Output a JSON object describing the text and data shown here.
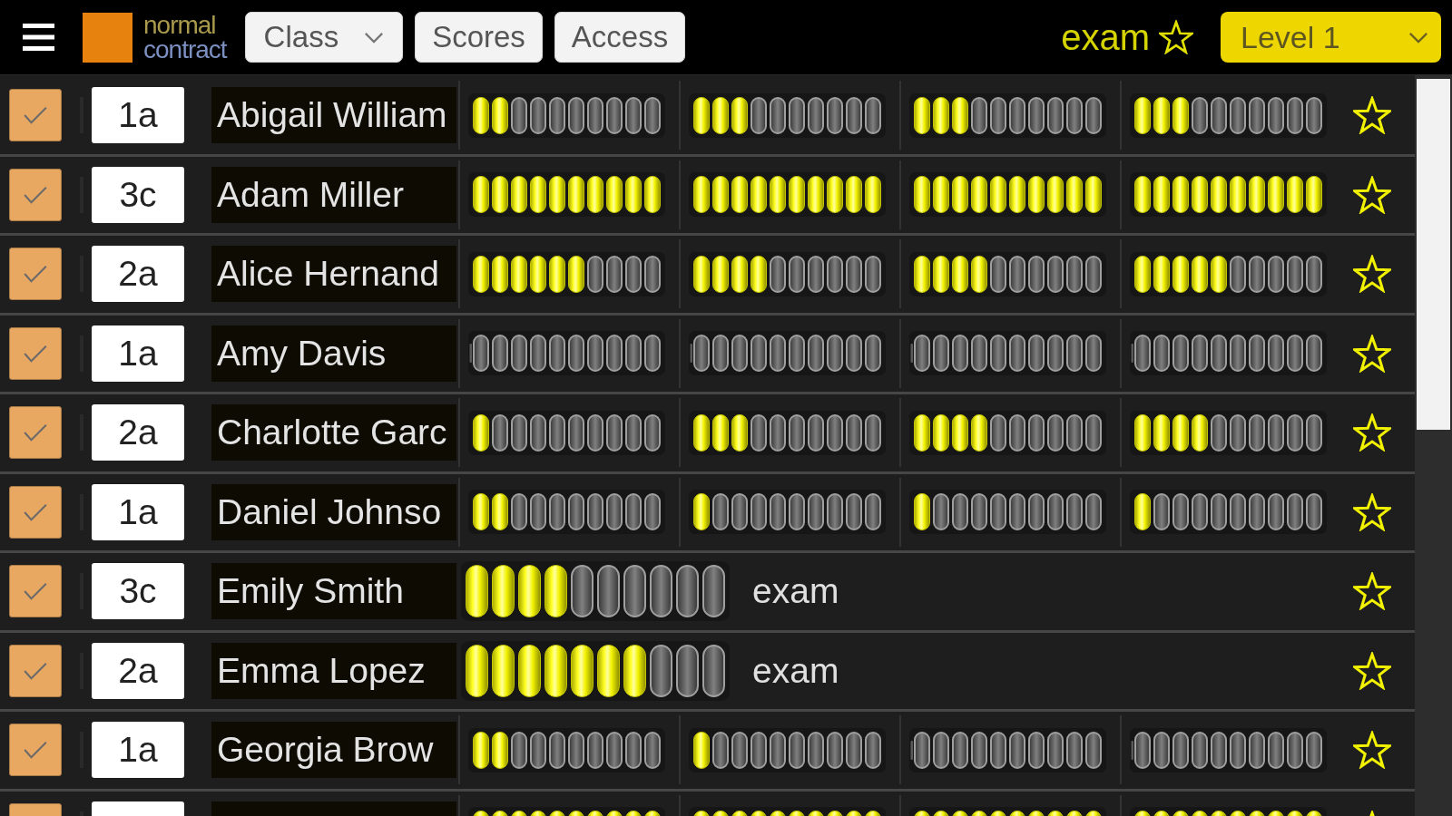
{
  "header": {
    "logo": {
      "line_1": "normal",
      "line_2": "contract"
    },
    "buttons": [
      {
        "label": "Class",
        "kind": "dropdown"
      },
      {
        "label": "Scores",
        "kind": "button"
      },
      {
        "label": "Access",
        "kind": "button"
      }
    ],
    "filter": {
      "label": "exam",
      "starred": false
    },
    "level_select": {
      "value": "Level 1"
    }
  },
  "rows": [
    {
      "checked": true,
      "class": "1a",
      "name": "Abigail William",
      "kind": "scores",
      "meters": [
        {
          "level": 0.2
        },
        {
          "level": 0.3
        },
        {
          "level": 0.3
        },
        {
          "level": 0.3
        }
      ],
      "starred": false
    },
    {
      "checked": true,
      "class": "3c",
      "name": "Adam Miller",
      "kind": "scores",
      "meters": [
        {
          "level": 1
        },
        {
          "level": 1
        },
        {
          "level": 1
        },
        {
          "level": 1
        }
      ],
      "starred": false
    },
    {
      "checked": true,
      "class": "2a",
      "name": "Alice Hernand",
      "kind": "scores",
      "meters": [
        {
          "level": 0.6
        },
        {
          "level": 0.4
        },
        {
          "level": 0.4
        },
        {
          "level": 0.5
        }
      ],
      "starred": false
    },
    {
      "checked": true,
      "class": "1a",
      "name": "Amy Davis",
      "kind": "scores",
      "meters": [
        {
          "level": 0
        },
        {
          "level": 0
        },
        {
          "level": 0
        },
        {
          "level": 0
        }
      ],
      "starred": false
    },
    {
      "checked": true,
      "class": "2a",
      "name": "Charlotte Garc",
      "kind": "scores",
      "meters": [
        {
          "level": 0.1
        },
        {
          "level": 0.3
        },
        {
          "level": 0.4
        },
        {
          "level": 0.4
        }
      ],
      "starred": false
    },
    {
      "checked": true,
      "class": "1a",
      "name": "Daniel Johnso",
      "kind": "scores",
      "meters": [
        {
          "level": 0.2
        },
        {
          "level": 0.1
        },
        {
          "level": 0.1
        },
        {
          "level": 0.1
        }
      ],
      "starred": false
    },
    {
      "checked": true,
      "class": "3c",
      "name": "Emily Smith",
      "kind": "exam",
      "meter": {
        "level": 0.4
      },
      "label": "exam",
      "starred": false
    },
    {
      "checked": true,
      "class": "2a",
      "name": "Emma Lopez",
      "kind": "exam",
      "meter": {
        "level": 0.7
      },
      "label": "exam",
      "starred": false
    },
    {
      "checked": true,
      "class": "1a",
      "name": "Georgia Brow",
      "kind": "scores",
      "meters": [
        {
          "level": 0.2
        },
        {
          "level": 0.1
        },
        {
          "level": 0
        },
        {
          "level": 0
        }
      ],
      "starred": false
    },
    {
      "checked": true,
      "kind": "scores",
      "meters": [
        {
          "level": 1
        },
        {
          "level": 1
        },
        {
          "level": 1
        },
        {
          "level": 1
        }
      ],
      "starred": false
    }
  ]
}
